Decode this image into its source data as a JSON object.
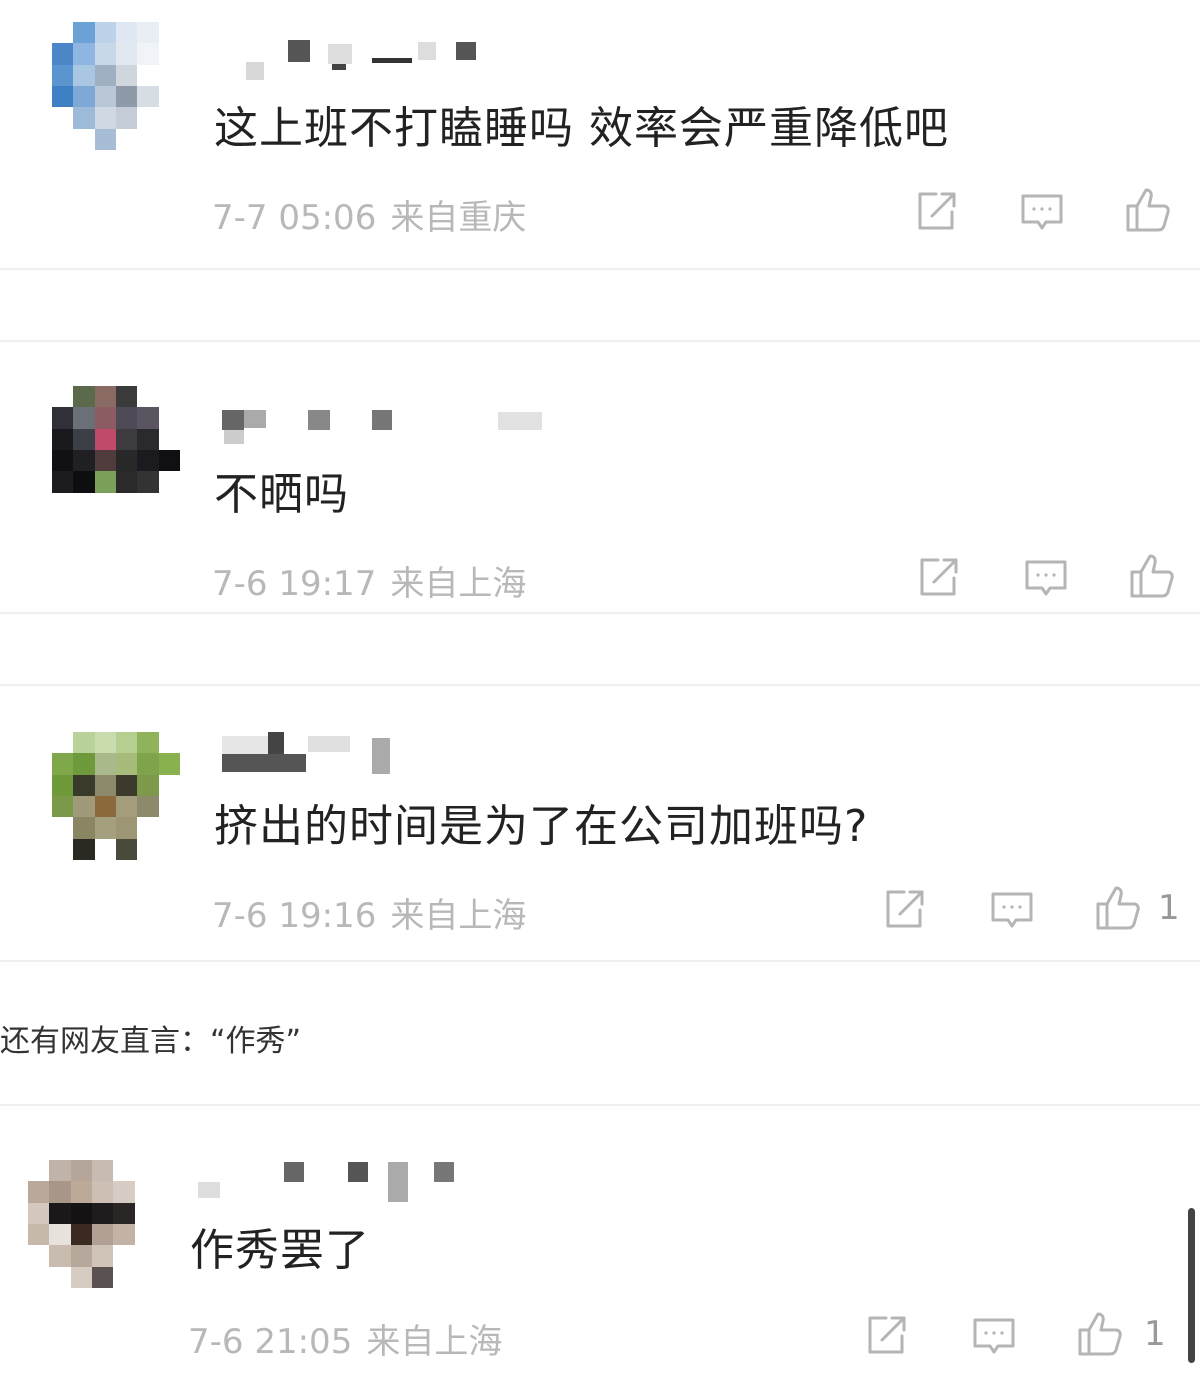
{
  "comments": [
    {
      "text": "这上班不打瞌睡吗 效率会严重降低吧",
      "time": "7-7 05:06",
      "location": "来自重庆",
      "likes": "",
      "avatar_colors": [
        "#ffffff",
        "#6aa2d8",
        "#bcd3ea",
        "#dfe8f2",
        "#e9eef5",
        "#ffffff",
        "#4a86c8",
        "#8fb6e0",
        "#c9d8e8",
        "#e2e8ef",
        "#f0f3f7",
        "#ffffff",
        "#5b95d0",
        "#a9c6e3",
        "#9fb0c2",
        "#cfd6de",
        "#ffffff",
        "#ffffff",
        "#3f7fc4",
        "#7ea9d6",
        "#b9c7d6",
        "#8e9aa8",
        "#d6dde5",
        "#ffffff",
        "#ffffff",
        "#9dbbd9",
        "#cfd9e4",
        "#c4cdd7",
        "#ffffff",
        "#ffffff",
        "#ffffff",
        "#ffffff",
        "#a7bdd5",
        "#ffffff",
        "#ffffff",
        "#ffffff"
      ]
    },
    {
      "text": "不晒吗",
      "time": "7-6 19:17",
      "location": "来自上海",
      "likes": "",
      "avatar_colors": [
        "#ffffff",
        "#5a6a4a",
        "#8a6b63",
        "#3b3b3b",
        "#ffffff",
        "#ffffff",
        "#2f3038",
        "#6a6f78",
        "#8d5b62",
        "#4e4a56",
        "#5a5560",
        "#ffffff",
        "#1a1a1e",
        "#3c3f47",
        "#c04a6a",
        "#3d3a40",
        "#2a2a2e",
        "#ffffff",
        "#111114",
        "#202024",
        "#503c3c",
        "#282828",
        "#1b1b1f",
        "#101012",
        "#1c1c20",
        "#0e0e10",
        "#7aa05a",
        "#2a2a2a",
        "#333",
        "#ffffff",
        "#ffffff",
        "#ffffff",
        "#ffffff",
        "#ffffff",
        "#ffffff",
        "#ffffff"
      ]
    },
    {
      "text": "挤出的时间是为了在公司加班吗?",
      "time": "7-6 19:16",
      "location": "来自上海",
      "likes": "1",
      "avatar_colors": [
        "#ffffff",
        "#b9d29a",
        "#c8dcae",
        "#b4cf8f",
        "#8fb35a",
        "#ffffff",
        "#7fa84a",
        "#6e9a3c",
        "#a9b98c",
        "#a7bc7a",
        "#7ea34a",
        "#88b250",
        "#6f9a3a",
        "#3a3a2a",
        "#8c8a6a",
        "#3b3a2b",
        "#7c9a4a",
        "#ffffff",
        "#7a9a4a",
        "#a09a7a",
        "#8a6a3a",
        "#a49d7c",
        "#8c8a6a",
        "#ffffff",
        "#ffffff",
        "#8a8664",
        "#a4a07e",
        "#9c9675",
        "#ffffff",
        "#ffffff",
        "#ffffff",
        "#2a2a22",
        "#ffffff",
        "#4a4a3a",
        "#ffffff",
        "#ffffff"
      ]
    },
    {
      "text": "作秀罢了",
      "time": "7-6 21:05",
      "location": "来自上海",
      "likes": "1",
      "avatar_colors": [
        "#ffffff",
        "#c2b3a8",
        "#b6a69a",
        "#c8bcb2",
        "#ffffff",
        "#ffffff",
        "#b9a99c",
        "#a89788",
        "#bda998",
        "#cdbfb3",
        "#d8cdc4",
        "#ffffff",
        "#d4c8be",
        "#1a1818",
        "#141212",
        "#1e1c1c",
        "#2a2626",
        "#ffffff",
        "#c6b8ab",
        "#e8e2dc",
        "#3a2a22",
        "#b0a194",
        "#c2b3a6",
        "#ffffff",
        "#ffffff",
        "#c9bbae",
        "#b8a89b",
        "#d0c3b7",
        "#ffffff",
        "#ffffff",
        "#ffffff",
        "#ffffff",
        "#d7ccc2",
        "#5a5250",
        "#ffffff",
        "#ffffff"
      ]
    }
  ],
  "caption": "还有网友直言：“作秀”",
  "icons": {
    "share": "share-icon",
    "comment": "comment-icon",
    "like": "thumbs-up-icon"
  }
}
